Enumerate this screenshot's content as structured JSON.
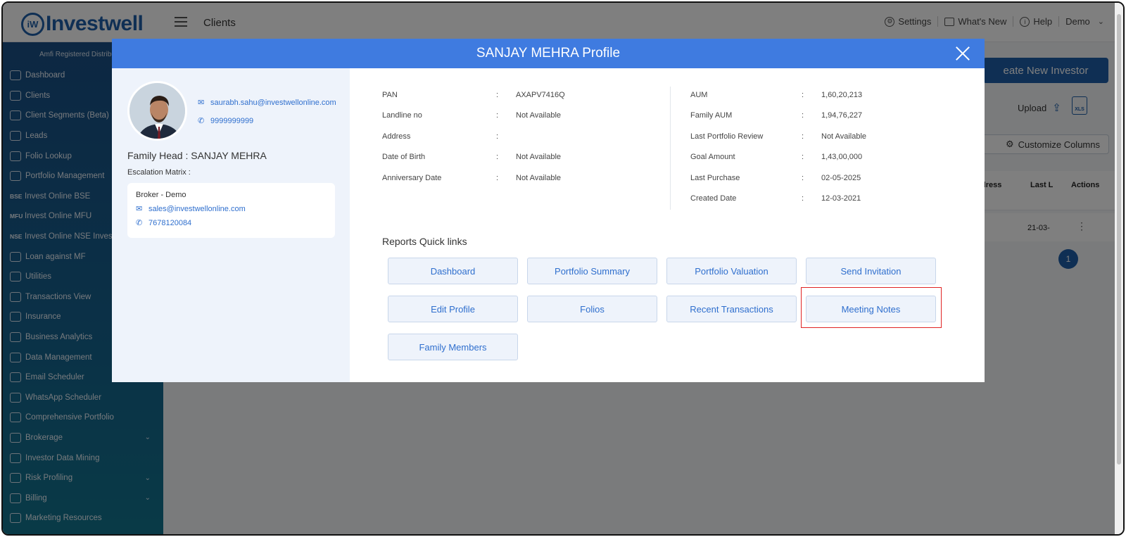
{
  "app": {
    "logo_text": "Investwell",
    "page_title": "Clients"
  },
  "topnav": {
    "settings": "Settings",
    "whats_new": "What's New",
    "help": "Help",
    "user": "Demo"
  },
  "sidebar": {
    "amfi": "Amfi Registered Distribu",
    "items": [
      {
        "label": "Dashboard",
        "icon": "home-icon"
      },
      {
        "label": "Clients",
        "icon": "clients-icon"
      },
      {
        "label": "Client Segments (Beta)",
        "icon": "segments-icon"
      },
      {
        "label": "Leads",
        "icon": "leads-icon"
      },
      {
        "label": "Folio Lookup",
        "icon": "folio-lookup-icon"
      },
      {
        "label": "Portfolio Management",
        "icon": "portfolio-icon"
      },
      {
        "label": "Invest Online BSE",
        "tag": "BSE"
      },
      {
        "label": "Invest Online MFU",
        "tag": "MFU"
      },
      {
        "label": "Invest Online NSE Invest",
        "tag": "NSE"
      },
      {
        "label": "Loan against MF",
        "icon": "loan-icon"
      },
      {
        "label": "Utilities",
        "icon": "utilities-icon"
      },
      {
        "label": "Transactions View",
        "icon": "transactions-icon"
      },
      {
        "label": "Insurance",
        "icon": "insurance-icon"
      },
      {
        "label": "Business Analytics",
        "icon": "analytics-icon"
      },
      {
        "label": "Data Management",
        "icon": "data-icon"
      },
      {
        "label": "Email Scheduler",
        "icon": "email-icon"
      },
      {
        "label": "WhatsApp Scheduler",
        "icon": "whatsapp-icon"
      },
      {
        "label": "Comprehensive Portfolio",
        "icon": "comprehensive-icon"
      },
      {
        "label": "Brokerage",
        "icon": "brokerage-icon",
        "expandable": true
      },
      {
        "label": "Investor Data Mining",
        "icon": "mining-icon"
      },
      {
        "label": "Risk Profiling",
        "icon": "risk-icon",
        "expandable": true
      },
      {
        "label": "Billing",
        "icon": "billing-icon",
        "expandable": true
      },
      {
        "label": "Marketing Resources",
        "icon": "marketing-icon"
      }
    ]
  },
  "main": {
    "create_button": "eate New Investor",
    "upload_label": "Upload",
    "xls_label": "XLS",
    "customize_label": "Customize Columns",
    "table_header": {
      "address": "dress",
      "last": "Last L",
      "actions": "Actions"
    },
    "row_date": "21-03-",
    "page_number": "1"
  },
  "modal": {
    "title": "SANJAY MEHRA Profile",
    "email": "saurabh.sahu@investwellonline.com",
    "phone": "9999999999",
    "family_head": "Family Head : SANJAY MEHRA",
    "escalation_label": "Escalation Matrix :",
    "escalation": {
      "broker": "Broker - Demo",
      "email": "sales@investwellonline.com",
      "phone": "7678120084"
    },
    "details_left": [
      {
        "label": "PAN",
        "value": "AXAPV7416Q"
      },
      {
        "label": "Landline no",
        "value": "Not Available"
      },
      {
        "label": "Address",
        "value": ""
      },
      {
        "label": "Date of Birth",
        "value": "Not Available"
      },
      {
        "label": "Anniversary Date",
        "value": "Not Available"
      }
    ],
    "details_right": [
      {
        "label": "AUM",
        "value": "1,60,20,213"
      },
      {
        "label": "Family AUM",
        "value": "1,94,76,227"
      },
      {
        "label": "Last Portfolio Review",
        "value": "Not Available"
      },
      {
        "label": "Goal Amount",
        "value": "1,43,00,000"
      },
      {
        "label": "Last Purchase",
        "value": "02-05-2025"
      },
      {
        "label": "Created Date",
        "value": "12-03-2021"
      }
    ],
    "quick_links_title": "Reports Quick links",
    "quick_links": [
      "Dashboard",
      "Portfolio Summary",
      "Portfolio Valuation",
      "Send Invitation",
      "Edit Profile",
      "Folios",
      "Recent Transactions",
      "Meeting Notes",
      "Family Members"
    ],
    "colon": ":"
  }
}
